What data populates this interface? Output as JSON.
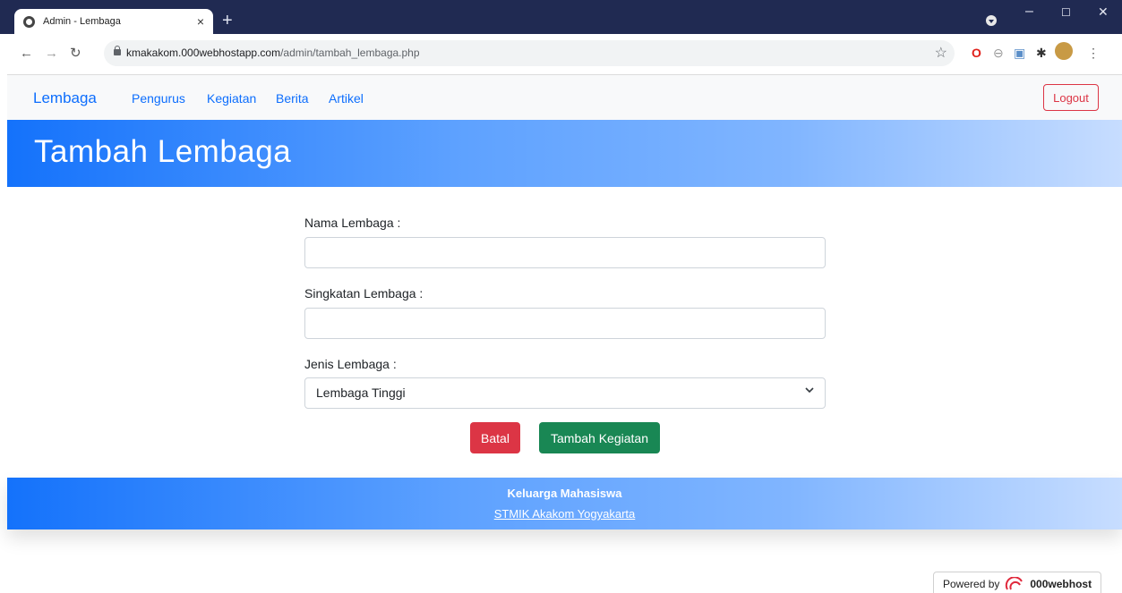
{
  "browser": {
    "tab_title": "Admin - Lembaga",
    "tab_close": "×",
    "new_tab": "+",
    "url_host": "kmakakom.000webhostapp.com",
    "url_path": "/admin/tambah_lembaga.php"
  },
  "navbar": {
    "brand": "Lembaga",
    "links": [
      "Pengurus",
      "Kegiatan",
      "Berita",
      "Artikel"
    ],
    "logout": "Logout"
  },
  "hero": {
    "title": "Tambah Lembaga"
  },
  "form": {
    "nama_label": "Nama Lembaga :",
    "nama_value": "",
    "singkatan_label": "Singkatan Lembaga :",
    "singkatan_value": "",
    "jenis_label": "Jenis Lembaga :",
    "jenis_selected": "Lembaga Tinggi",
    "batal": "Batal",
    "submit": "Tambah Kegiatan"
  },
  "footer": {
    "title": "Keluarga Mahasiswa",
    "link": "STMIK Akakom Yogyakarta"
  },
  "powered": {
    "prefix": "Powered by",
    "brand": "000webhost"
  },
  "colors": {
    "primary": "#0d6efd",
    "danger": "#dc3545",
    "success": "#198754",
    "titlebar": "#202a52"
  }
}
